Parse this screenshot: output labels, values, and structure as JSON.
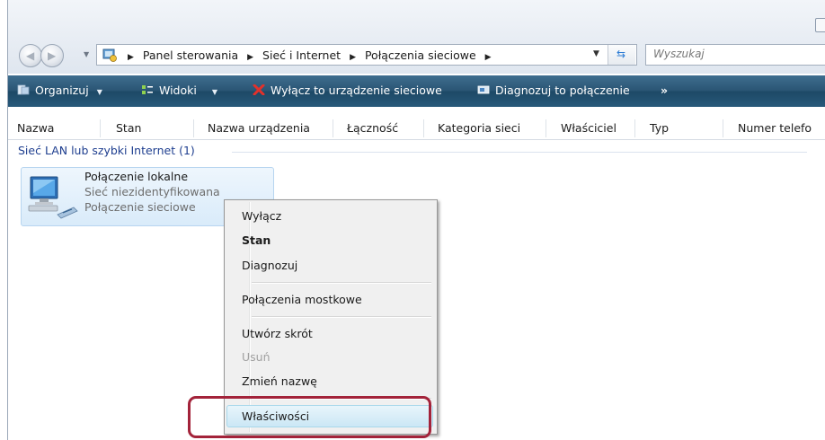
{
  "breadcrumb": [
    "Panel sterowania",
    "Sieć i Internet",
    "Połączenia sieciowe"
  ],
  "search": {
    "placeholder": "Wyszukaj"
  },
  "toolbar": {
    "organize": "Organizuj",
    "views": "Widoki",
    "disable_device": "Wyłącz to urządzenie sieciowe",
    "diagnose": "Diagnozuj to połączenie",
    "more": "»"
  },
  "columns": [
    "Nazwa",
    "Stan",
    "Nazwa urządzenia",
    "Łączność",
    "Kategoria sieci",
    "Właściciel",
    "Typ",
    "Numer telefo"
  ],
  "group": {
    "header": "Sieć LAN lub szybki Internet (1)"
  },
  "item": {
    "title": "Połączenie lokalne",
    "line2": "Sieć niezidentyfikowana",
    "line3": "Połączenie sieciowe"
  },
  "context_menu": {
    "disable": "Wyłącz",
    "status": "Stan",
    "diagnose": "Diagnozuj",
    "bridge": "Połączenia mostkowe",
    "shortcut": "Utwórz skrót",
    "delete": "Usuń",
    "rename": "Zmień nazwę",
    "properties": "Właściwości"
  },
  "colors": {
    "command_bar": "#28597a",
    "group_header": "#1e3e8f",
    "highlight_callout": "#a3233a",
    "menu_background": "#f0f0f0"
  }
}
